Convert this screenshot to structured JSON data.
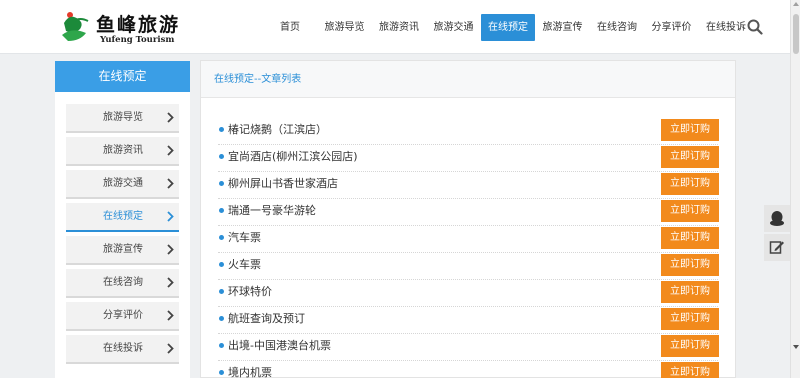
{
  "header": {
    "logo_cn": "鱼峰旅游",
    "logo_en": "Yufeng Tourism",
    "nav": [
      {
        "label": "首页",
        "active": false
      },
      {
        "label": "旅游导览",
        "active": false
      },
      {
        "label": "旅游资讯",
        "active": false
      },
      {
        "label": "旅游交通",
        "active": false
      },
      {
        "label": "在线预定",
        "active": true
      },
      {
        "label": "旅游宣传",
        "active": false
      },
      {
        "label": "在线咨询",
        "active": false
      },
      {
        "label": "分享评价",
        "active": false
      },
      {
        "label": "在线投诉",
        "active": false
      }
    ]
  },
  "sidebar": {
    "title": "在线预定",
    "items": [
      {
        "label": "旅游导览",
        "active": false
      },
      {
        "label": "旅游资讯",
        "active": false
      },
      {
        "label": "旅游交通",
        "active": false
      },
      {
        "label": "在线预定",
        "active": true
      },
      {
        "label": "旅游宣传",
        "active": false
      },
      {
        "label": "在线咨询",
        "active": false
      },
      {
        "label": "分享评价",
        "active": false
      },
      {
        "label": "在线投诉",
        "active": false
      }
    ]
  },
  "main": {
    "title": "在线预定--文章列表",
    "button_label": "立即订购",
    "articles": [
      "椿记烧鹅（江滨店）",
      "宜尚酒店(柳州江滨公园店)",
      "柳州屏山书香世家酒店",
      "瑞通一号豪华游轮",
      "汽车票",
      "火车票",
      "环球特价",
      "航班查询及预订",
      "出境-中国港澳台机票",
      "境内机票"
    ]
  },
  "colors": {
    "accent": "#2b8fd7",
    "sidebar_title": "#3a9ee6",
    "button": "#f28a1c"
  },
  "icons": {
    "search": "search-icon",
    "qq": "qq-penguin-icon",
    "feedback": "edit-icon",
    "chevron": "chevron-right-icon"
  }
}
